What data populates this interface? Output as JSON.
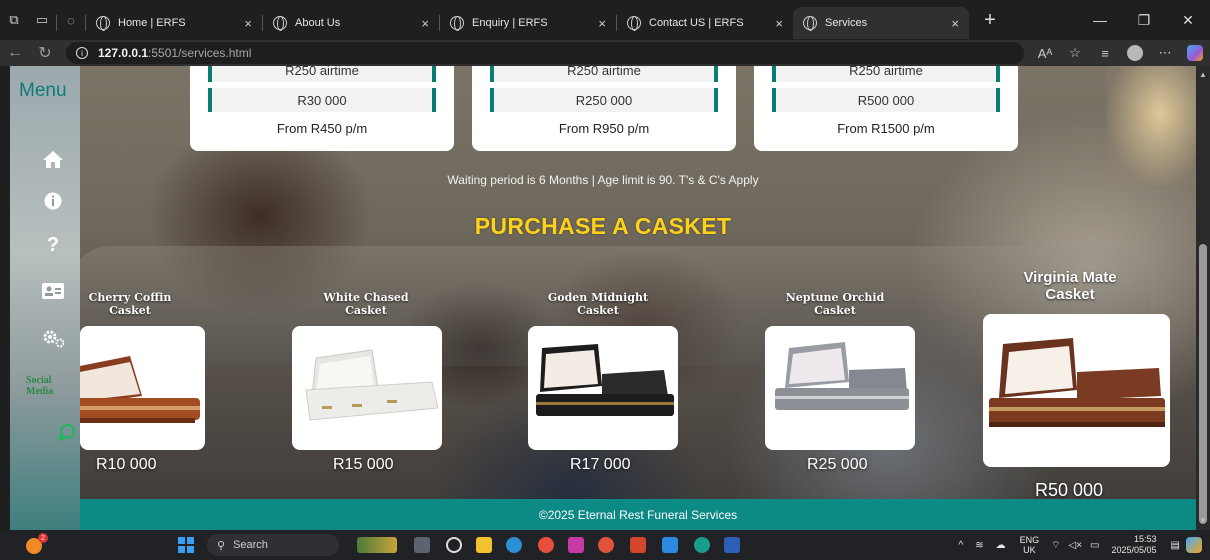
{
  "browser": {
    "tabs": [
      {
        "title": "Home | ERFS",
        "active": false
      },
      {
        "title": "About Us",
        "active": false
      },
      {
        "title": "Enquiry | ERFS",
        "active": false
      },
      {
        "title": "Contact US | ERFS",
        "active": false
      },
      {
        "title": "Services",
        "active": true
      }
    ],
    "tab_close": "×",
    "new_tab": "+",
    "url_host": "127.0.0.1",
    "url_path": ":5501/services.html"
  },
  "sidebar": {
    "menu_title": "Menu",
    "icons": [
      "home-icon",
      "info-icon",
      "question-icon",
      "contact-card-icon",
      "settings-icon"
    ],
    "question_glyph": "?",
    "social_label": "Social Media"
  },
  "plans": [
    {
      "airtime": "R250 airtime",
      "cover": "R30 000",
      "premium": "From R450 p/m"
    },
    {
      "airtime": "R250 airtime",
      "cover": "R250 000",
      "premium": "From R950 p/m"
    },
    {
      "airtime": "R250 airtime",
      "cover": "R500 000",
      "premium": "From R1500 p/m"
    }
  ],
  "waiting_notice": "Waiting period is 6 Months | Age limit is 90. T's & C's Apply",
  "purchase_title": "PURCHASE A CASKET",
  "caskets": [
    {
      "name_line1": "Cherry Coffin",
      "name_line2": "Casket",
      "price": "R10 000",
      "color": "#8a3d1e"
    },
    {
      "name_line1": "White Chased",
      "name_line2": "Casket",
      "price": "R15 000",
      "color": "#e4e4e0"
    },
    {
      "name_line1": "Goden Midnight",
      "name_line2": "Casket",
      "price": "R17 000",
      "color": "#1d1d1d"
    },
    {
      "name_line1": "Neptune Orchid",
      "name_line2": "Casket",
      "price": "R25 000",
      "color": "#8d8f96"
    },
    {
      "name_line1": "Virginia Mate",
      "name_line2": "Casket",
      "price": "R50 000",
      "color": "#6a3320"
    }
  ],
  "footer": "©2025 Eternal Rest Funeral Services",
  "taskbar": {
    "search_label": "Search",
    "weather_badge": "2",
    "lang_line1": "ENG",
    "lang_line2": "UK",
    "time": "15:53",
    "date": "2025/05/05"
  },
  "colors": {
    "accent_teal": "#0c8a86",
    "title_yellow": "#ffd21a"
  }
}
